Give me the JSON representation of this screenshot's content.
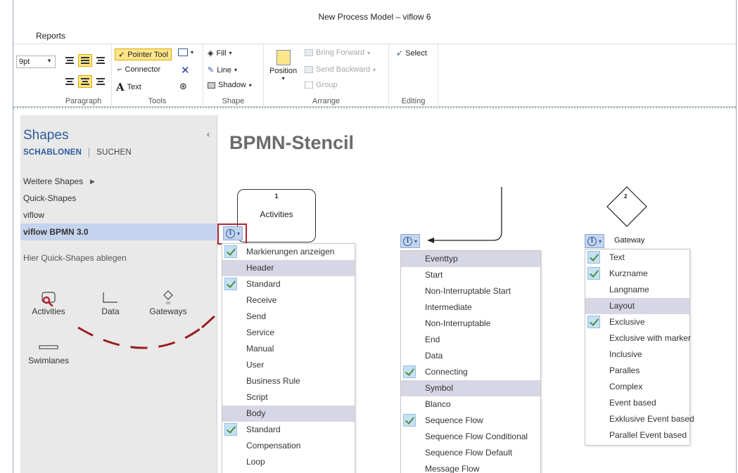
{
  "window": {
    "title": "New Process Model – viflow 6"
  },
  "menu": {
    "items": [
      "Reports"
    ]
  },
  "ribbon": {
    "font_size": "9pt",
    "groups": {
      "paragraph": {
        "label": "Paragraph"
      },
      "tools": {
        "label": "Tools",
        "pointer_tool": "Pointer Tool",
        "connector": "Connector",
        "text": "Text"
      },
      "shape": {
        "label": "Shape",
        "fill": "Fill",
        "line": "Line",
        "shadow": "Shadow"
      },
      "arrange": {
        "label": "Arrange",
        "position": "Position",
        "bring_forward": "Bring Forward",
        "send_backward": "Send Backward",
        "group": "Group"
      },
      "editing": {
        "label": "Editing",
        "select": "Select"
      }
    }
  },
  "shapes_panel": {
    "title": "Shapes",
    "tabs": [
      "SCHABLONEN",
      "SUCHEN"
    ],
    "items": [
      "Weitere Shapes",
      "Quick-Shapes",
      "viflow",
      "viflow BPMN 3.0"
    ],
    "hint": "Hier Quick-Shapes ablegen",
    "tiles": [
      "Activities",
      "Data",
      "Gateways",
      "Swimlanes"
    ]
  },
  "canvas": {
    "heading": "BPMN-Stencil",
    "activity_box": {
      "number": "1",
      "label": "Activities"
    },
    "gateway": {
      "number": "2",
      "label": "Gateway"
    }
  },
  "menus": {
    "activities": {
      "rows": [
        {
          "label": "Markierungen anzeigen",
          "checked": true
        },
        {
          "label": "Header",
          "header": true
        },
        {
          "label": "Standard",
          "checked": true
        },
        {
          "label": "Receive"
        },
        {
          "label": "Send"
        },
        {
          "label": "Service"
        },
        {
          "label": "Manual"
        },
        {
          "label": "User"
        },
        {
          "label": "Business Rule"
        },
        {
          "label": "Script"
        },
        {
          "label": "Body",
          "header": true
        },
        {
          "label": "Standard",
          "checked": true
        },
        {
          "label": "Compensation"
        },
        {
          "label": "Loop"
        }
      ]
    },
    "events": {
      "rows": [
        {
          "label": "Eventtyp",
          "header": true
        },
        {
          "label": "Start"
        },
        {
          "label": "Non-Interruptable Start"
        },
        {
          "label": "Intermediate"
        },
        {
          "label": "Non-Interruptable"
        },
        {
          "label": "End"
        },
        {
          "label": "Data"
        },
        {
          "label": "Connecting",
          "checked": true
        },
        {
          "label": "Symbol",
          "header": true
        },
        {
          "label": "Blanco"
        },
        {
          "label": "Sequence Flow",
          "checked": true
        },
        {
          "label": "Sequence Flow Conditional"
        },
        {
          "label": "Sequence Flow Default"
        },
        {
          "label": "Message Flow"
        }
      ]
    },
    "gateway": {
      "rows": [
        {
          "label": "Text",
          "checked": true
        },
        {
          "label": "Kurzname",
          "checked": true
        },
        {
          "label": "Langname"
        },
        {
          "label": "Layout",
          "header": true
        },
        {
          "label": "Exclusive",
          "checked": true
        },
        {
          "label": "Exclusive with marker"
        },
        {
          "label": "Inclusive"
        },
        {
          "label": "Paralles"
        },
        {
          "label": "Complex"
        },
        {
          "label": "Event based"
        },
        {
          "label": "Exklusive Event based"
        },
        {
          "label": "Parallel Event based"
        }
      ]
    }
  },
  "colors": {
    "accent": "#2e5b9a",
    "highlight": "#b3262f",
    "menu_header": "#d6d6e4",
    "selected_tool": "#fde68a"
  }
}
